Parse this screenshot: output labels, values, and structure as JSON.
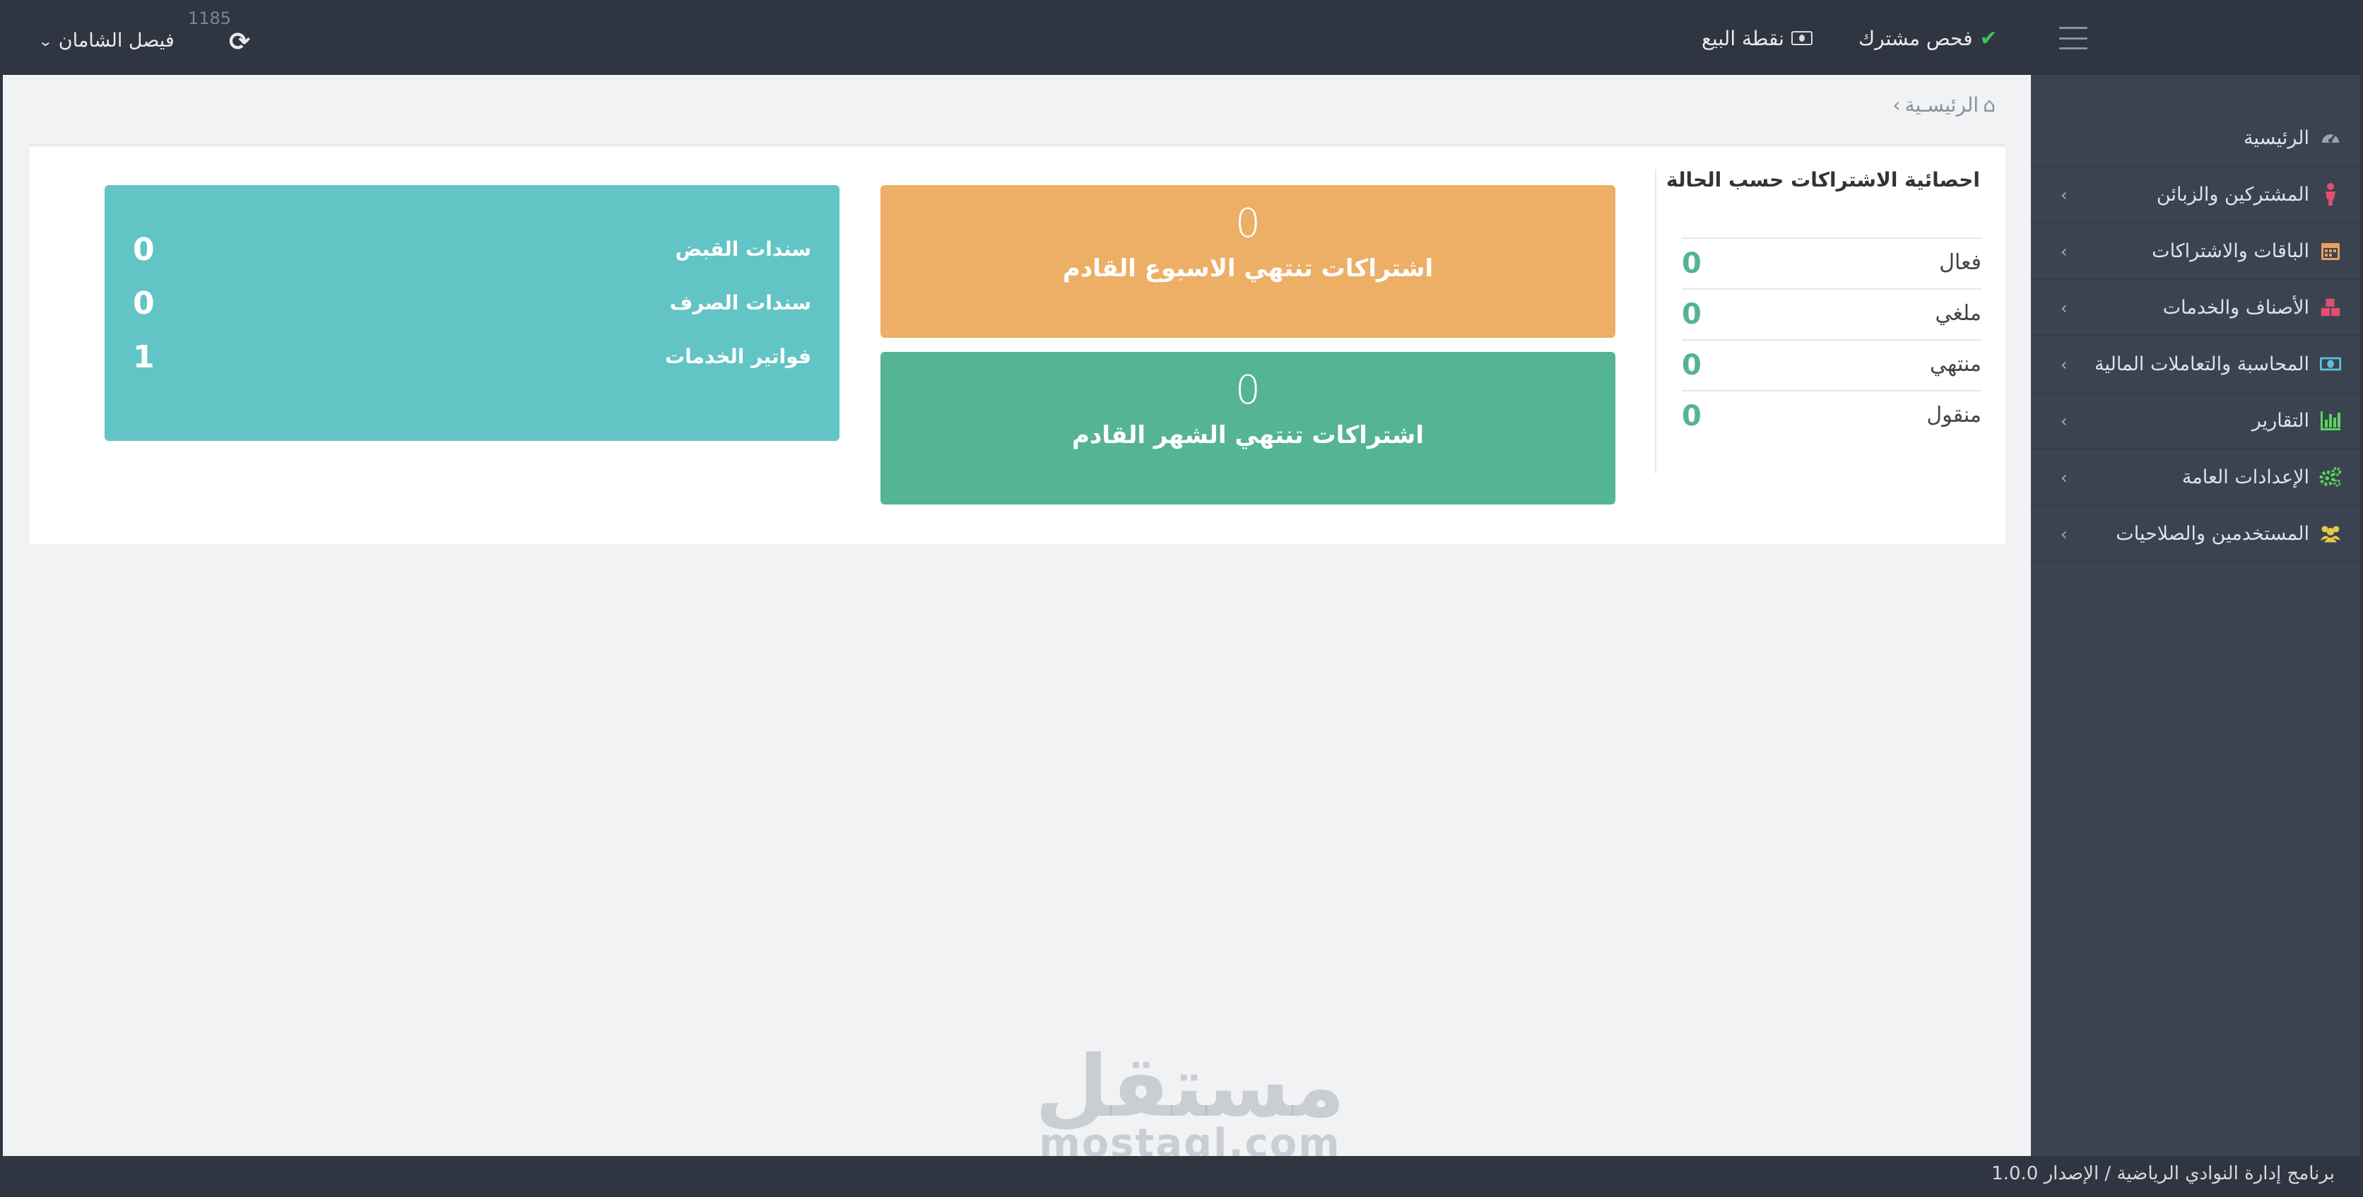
{
  "topbar": {
    "check_subscriber": "فحص مشترك",
    "point_of_sale": "نقطة البيع",
    "counter": "1185",
    "user_name": "فيصل الشامان"
  },
  "breadcrumb": {
    "home": "الرئيسـية"
  },
  "sidebar": {
    "items": [
      {
        "label": "الرئيسية",
        "icon": "dashboard-icon",
        "color": "#9aa1aa"
      },
      {
        "label": "المشتركين والزبائن",
        "icon": "person-icon",
        "color": "#e0506e"
      },
      {
        "label": "الباقات والاشتراكات",
        "icon": "calendar-icon",
        "color": "#e8a163"
      },
      {
        "label": "الأصناف والخدمات",
        "icon": "cubes-icon",
        "color": "#e0506e"
      },
      {
        "label": "المحاسبة والتعاملات المالية",
        "icon": "money-icon",
        "color": "#5bc0de"
      },
      {
        "label": "التقارير",
        "icon": "bar-chart-icon",
        "color": "#5cd65c"
      },
      {
        "label": "الإعدادات العامة",
        "icon": "cogs-icon",
        "color": "#5cd65c"
      },
      {
        "label": "المستخدمين والصلاحيات",
        "icon": "users-icon",
        "color": "#e6c84a"
      }
    ]
  },
  "stats": {
    "title": "احصائية الاشتراكات حسب الحالة",
    "rows": [
      {
        "label": "فعال",
        "value": "0"
      },
      {
        "label": "ملغي",
        "value": "0"
      },
      {
        "label": "منتهي",
        "value": "0"
      },
      {
        "label": "منقول",
        "value": "0"
      }
    ]
  },
  "expiring": {
    "week": {
      "value": "0",
      "label": "اشتراكات تنتهي الاسبوع القادم"
    },
    "month": {
      "value": "0",
      "label": "اشتراكات تنتهي الشهر القادم"
    }
  },
  "vouchers": [
    {
      "label": "سندات القبض",
      "value": "0"
    },
    {
      "label": "سندات الصرف",
      "value": "0"
    },
    {
      "label": "فواتير الخدمات",
      "value": "1"
    }
  ],
  "watermark": {
    "arabic": "مستقل",
    "latin": "mostaql.com"
  },
  "footer": {
    "text": "برنامج إدارة النوادي الرياضية / الإصدار 1.0.0"
  },
  "colors": {
    "topbar": "#2f3642",
    "sidebar": "#3b4350",
    "orange_card": "#edae66",
    "green_card": "#55b396",
    "teal_card": "#62c4c5",
    "stat_number": "#55b394"
  }
}
